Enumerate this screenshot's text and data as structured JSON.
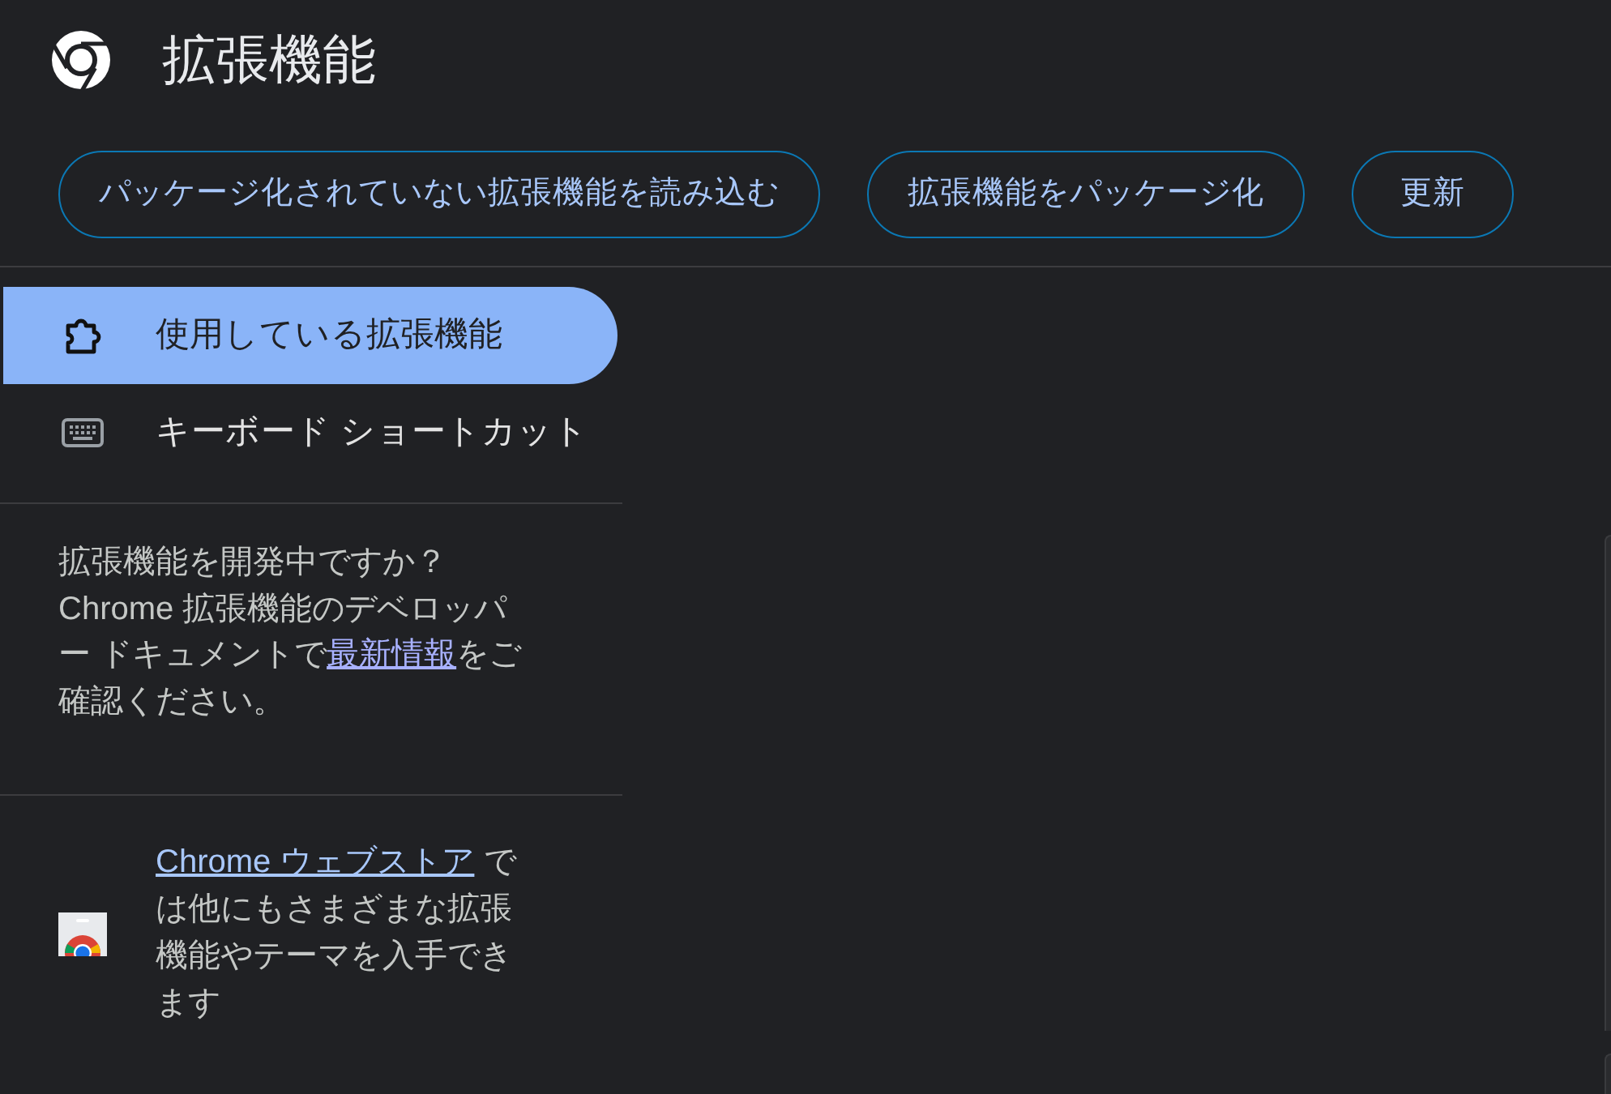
{
  "header": {
    "title": "拡張機能"
  },
  "toolbar": {
    "buttons": [
      {
        "label": "パッケージ化されていない拡張機能を読み込む"
      },
      {
        "label": "拡張機能をパッケージ化"
      },
      {
        "label": "更新"
      }
    ]
  },
  "sidebar": {
    "items": [
      {
        "label": "使用している拡張機能",
        "selected": true
      },
      {
        "label": "キーボード ショートカット",
        "selected": false
      }
    ],
    "developer_note": {
      "text_before": "拡張機能を開発中ですか？Chrome 拡張機能のデベロッパー ドキュメントで",
      "link": "最新情報",
      "text_after": "をご確認ください。"
    },
    "store_promo": {
      "link": "Chrome ウェブストア",
      "text_after": " では他にもさまざまな拡張機能やテーマを入手できます"
    }
  }
}
